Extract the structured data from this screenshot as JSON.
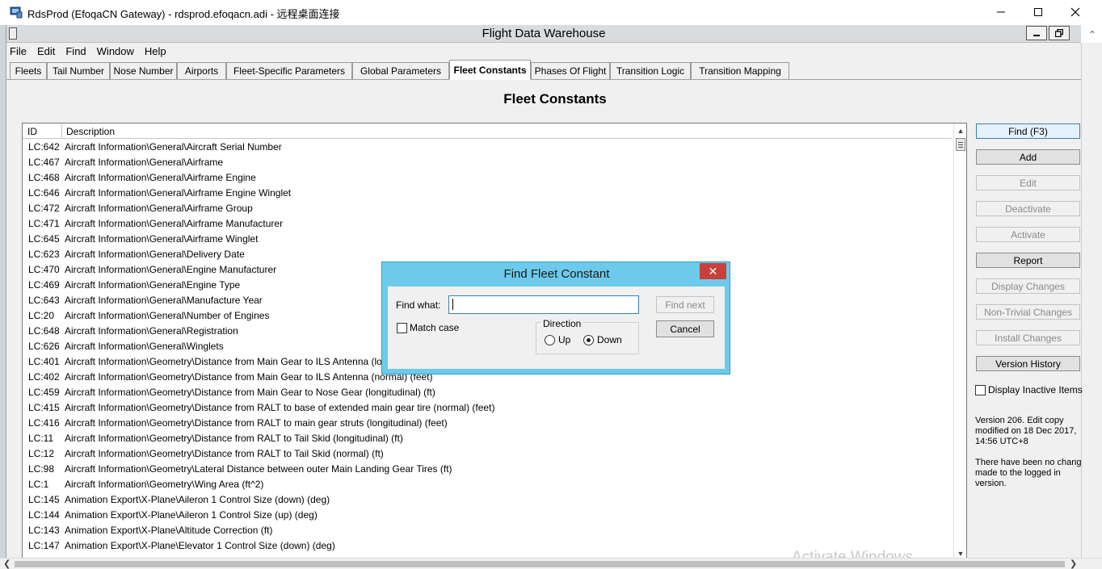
{
  "window": {
    "title": "RdsProd (EfoqaCN Gateway) - rdsprod.efoqacn.adi - 远程桌面连接",
    "minimize_glyph": "—",
    "maximize_glyph": "☐",
    "close_glyph": "✕"
  },
  "app": {
    "title": "Flight Data Warehouse",
    "scroll_arrow": "⌃"
  },
  "menu": [
    "File",
    "Edit",
    "Find",
    "Window",
    "Help"
  ],
  "tabs": [
    {
      "label": "Fleets",
      "active": false
    },
    {
      "label": "Tail Number",
      "active": false
    },
    {
      "label": "Nose Number",
      "active": false
    },
    {
      "label": "Airports",
      "active": false
    },
    {
      "label": "Fleet-Specific Parameters",
      "active": false
    },
    {
      "label": "Global Parameters",
      "active": false
    },
    {
      "label": "Fleet Constants",
      "active": true
    },
    {
      "label": "Phases Of Flight",
      "active": false
    },
    {
      "label": "Transition Logic",
      "active": false
    },
    {
      "label": "Transition Mapping",
      "active": false
    }
  ],
  "page": {
    "heading": "Fleet Constants"
  },
  "list": {
    "columns": {
      "id": "ID",
      "description": "Description"
    },
    "rows": [
      {
        "id": "LC:642",
        "description": "Aircraft Information\\General\\Aircraft Serial Number"
      },
      {
        "id": "LC:467",
        "description": "Aircraft Information\\General\\Airframe"
      },
      {
        "id": "LC:468",
        "description": "Aircraft Information\\General\\Airframe Engine"
      },
      {
        "id": "LC:646",
        "description": "Aircraft Information\\General\\Airframe Engine Winglet"
      },
      {
        "id": "LC:472",
        "description": "Aircraft Information\\General\\Airframe Group"
      },
      {
        "id": "LC:471",
        "description": "Aircraft Information\\General\\Airframe Manufacturer"
      },
      {
        "id": "LC:645",
        "description": "Aircraft Information\\General\\Airframe Winglet"
      },
      {
        "id": "LC:623",
        "description": "Aircraft Information\\General\\Delivery Date"
      },
      {
        "id": "LC:470",
        "description": "Aircraft Information\\General\\Engine Manufacturer"
      },
      {
        "id": "LC:469",
        "description": "Aircraft Information\\General\\Engine Type"
      },
      {
        "id": "LC:643",
        "description": "Aircraft Information\\General\\Manufacture Year"
      },
      {
        "id": "LC:20",
        "description": "Aircraft Information\\General\\Number of Engines"
      },
      {
        "id": "LC:648",
        "description": "Aircraft Information\\General\\Registration"
      },
      {
        "id": "LC:626",
        "description": "Aircraft Information\\General\\Winglets"
      },
      {
        "id": "LC:401",
        "description": "Aircraft Information\\Geometry\\Distance from Main Gear to ILS Antenna (lo"
      },
      {
        "id": "LC:402",
        "description": "Aircraft Information\\Geometry\\Distance from Main Gear to ILS Antenna (normal) (feet)"
      },
      {
        "id": "LC:459",
        "description": "Aircraft Information\\Geometry\\Distance from Main Gear to Nose Gear (longitudinal) (ft)"
      },
      {
        "id": "LC:415",
        "description": "Aircraft Information\\Geometry\\Distance from RALT to base of extended main gear tire (normal) (feet)"
      },
      {
        "id": "LC:416",
        "description": "Aircraft Information\\Geometry\\Distance from RALT to main gear struts (longitudinal) (feet)"
      },
      {
        "id": "LC:11",
        "description": "Aircraft Information\\Geometry\\Distance from RALT to Tail Skid (longitudinal) (ft)"
      },
      {
        "id": "LC:12",
        "description": "Aircraft Information\\Geometry\\Distance from RALT to Tail Skid (normal) (ft)"
      },
      {
        "id": "LC:98",
        "description": "Aircraft Information\\Geometry\\Lateral Distance between outer Main Landing Gear Tires (ft)"
      },
      {
        "id": "LC:1",
        "description": "Aircraft Information\\Geometry\\Wing Area (ft^2)"
      },
      {
        "id": "LC:145",
        "description": "Animation Export\\X-Plane\\Aileron 1 Control Size (down) (deg)"
      },
      {
        "id": "LC:144",
        "description": "Animation Export\\X-Plane\\Aileron 1 Control Size (up) (deg)"
      },
      {
        "id": "LC:143",
        "description": "Animation Export\\X-Plane\\Altitude Correction (ft)"
      },
      {
        "id": "LC:147",
        "description": "Animation Export\\X-Plane\\Elevator 1 Control Size (down) (deg)"
      }
    ]
  },
  "actions": [
    {
      "label": "Find  (F3)",
      "state": "focused"
    },
    {
      "label": "Add",
      "state": "enabled"
    },
    {
      "label": "Edit",
      "state": "disabled"
    },
    {
      "label": "Deactivate",
      "state": "disabled"
    },
    {
      "label": "Activate",
      "state": "disabled"
    },
    {
      "label": "Report",
      "state": "enabled"
    },
    {
      "label": "Display Changes",
      "state": "disabled"
    },
    {
      "label": "Non-Trivial Changes",
      "state": "disabled"
    },
    {
      "label": "Install Changes",
      "state": "disabled"
    },
    {
      "label": "Version History",
      "state": "enabled"
    }
  ],
  "display_inactive_label": "Display Inactive Items",
  "version": {
    "line1": "Version 206.  Edit copy",
    "line2": "modified on 18 Dec 2017,",
    "line3": "14:56 UTC+8",
    "line4": "There have been no changes",
    "line5": "made to the logged in",
    "line6": "version."
  },
  "watermark": "Activate Windows",
  "dialog": {
    "title": "Find Fleet Constant",
    "close_glyph": "✕",
    "find_what_label": "Find what:",
    "find_what_value": "",
    "find_next_label": "Find next",
    "cancel_label": "Cancel",
    "match_case_label": "Match case",
    "direction_label": "Direction",
    "up_label": "Up",
    "down_label": "Down",
    "direction_selected": "Down"
  },
  "scroll": {
    "up_glyph": "▲",
    "down_glyph": "▼",
    "left_glyph": "❮",
    "right_glyph": "❯"
  }
}
